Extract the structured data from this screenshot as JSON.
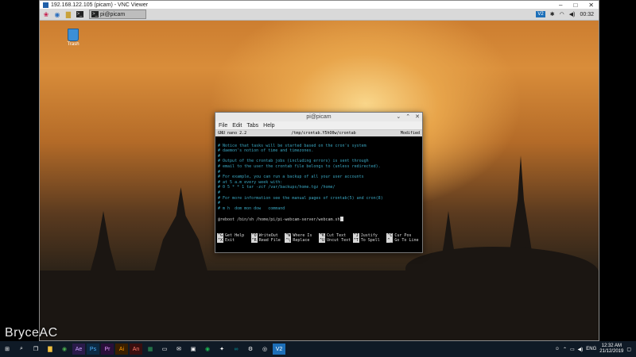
{
  "vnc": {
    "title": "192.168.122.105 (picam) - VNC Viewer",
    "min": "–",
    "max": "□",
    "close": "✕"
  },
  "pi_taskbar": {
    "terminal_task": "pi@picam",
    "vnc_badge": "V2",
    "clock": "00:32"
  },
  "desktop": {
    "trash_label": "Trash"
  },
  "terminal": {
    "title": "pi@picam",
    "menu": [
      "File",
      "Edit",
      "Tabs",
      "Help"
    ],
    "nano_version": "GNU nano 2.2",
    "file_path": "/tmp/crontab.Y5hO0w/crontab",
    "status": "Modified",
    "lines": [
      "# Notice that tasks will be started based on the cron's system",
      "# daemon's notion of time and timezones.",
      "#",
      "# Output of the crontab jobs (including errors) is sent through",
      "# email to the user the crontab file belongs to (unless redirected).",
      "#",
      "# For example, you can run a backup of all your user accounts",
      "# at 5 a.m every week with:",
      "# 0 5 * * 1 tar -zcf /var/backups/home.tgz /home/",
      "#",
      "# For more information see the manual pages of crontab(5) and cron(8)",
      "#",
      "# m h  dom mon dow   command",
      ""
    ],
    "command_line": "@reboot /bin/sh /home/pi/pi-webcam-server/webcam.sh",
    "help_row1": [
      {
        "key": "^G",
        "label": "Get Help"
      },
      {
        "key": "^O",
        "label": "WriteOut"
      },
      {
        "key": "^W",
        "label": "Where Is"
      },
      {
        "key": "^K",
        "label": "Cut Text"
      },
      {
        "key": "^J",
        "label": "Justify"
      },
      {
        "key": "^C",
        "label": "Cur Pos"
      }
    ],
    "help_row2": [
      {
        "key": "^X",
        "label": "Exit"
      },
      {
        "key": "^R",
        "label": "Read File"
      },
      {
        "key": "^\\",
        "label": "Replace"
      },
      {
        "key": "^U",
        "label": "Uncut Text"
      },
      {
        "key": "^T",
        "label": "To Spell"
      },
      {
        "key": "^_",
        "label": "Go To Line"
      }
    ]
  },
  "windows": {
    "lang": "ENG",
    "time": "12:32 AM",
    "date": "21/12/2019"
  },
  "watermark": "BryceAC"
}
